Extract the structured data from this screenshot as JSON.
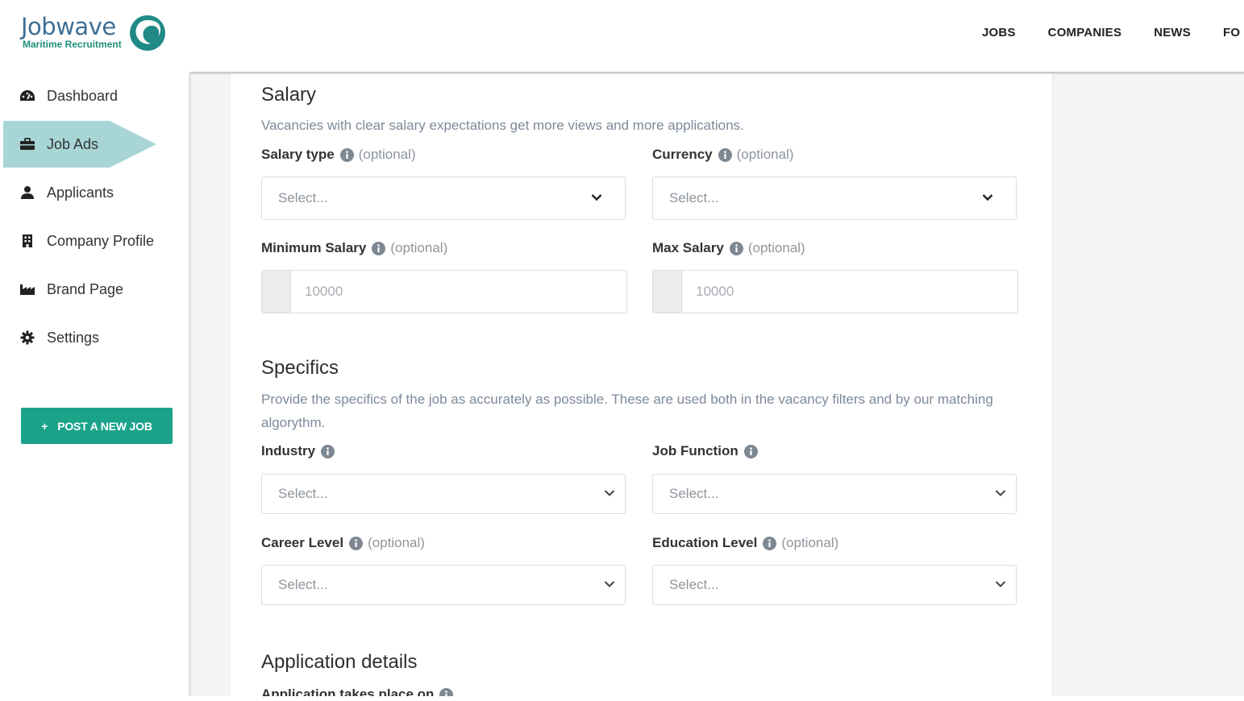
{
  "brand": {
    "name": "Jobwave",
    "tagline": "Maritime Recruitment"
  },
  "nav": {
    "items": [
      "JOBS",
      "COMPANIES",
      "NEWS",
      "FO"
    ]
  },
  "sidebar": {
    "items": [
      {
        "label": "Dashboard",
        "icon": "dashboard-icon"
      },
      {
        "label": "Job Ads",
        "icon": "briefcase-icon",
        "active": true
      },
      {
        "label": "Applicants",
        "icon": "user-icon"
      },
      {
        "label": "Company Profile",
        "icon": "building-icon"
      },
      {
        "label": "Brand Page",
        "icon": "factory-icon"
      },
      {
        "label": "Settings",
        "icon": "gear-icon"
      }
    ],
    "post_button": "POST A NEW JOB"
  },
  "colors": {
    "accent": "#1ba38a",
    "active_bg": "#a8d5d6",
    "brand_blue": "#3d6f96"
  },
  "salary": {
    "title": "Salary",
    "description": "Vacancies with clear salary expectations get more views and more applications.",
    "salary_type": {
      "label": "Salary type",
      "optional": "(optional)",
      "placeholder": "Select..."
    },
    "currency": {
      "label": "Currency",
      "optional": "(optional)",
      "placeholder": "Select..."
    },
    "min_salary": {
      "label": "Minimum Salary",
      "optional": "(optional)",
      "placeholder": "10000"
    },
    "max_salary": {
      "label": "Max Salary",
      "optional": "(optional)",
      "placeholder": "10000"
    }
  },
  "specifics": {
    "title": "Specifics",
    "description": "Provide the specifics of the job as accurately as possible. These are used both in the vacancy filters and by our matching algorythm.",
    "industry": {
      "label": "Industry",
      "placeholder": "Select..."
    },
    "job_function": {
      "label": "Job Function",
      "placeholder": "Select..."
    },
    "career_level": {
      "label": "Career Level",
      "optional": "(optional)",
      "placeholder": "Select..."
    },
    "education_level": {
      "label": "Education Level",
      "optional": "(optional)",
      "placeholder": "Select..."
    }
  },
  "application": {
    "title": "Application details",
    "takes_place_label": "Application takes place on"
  }
}
